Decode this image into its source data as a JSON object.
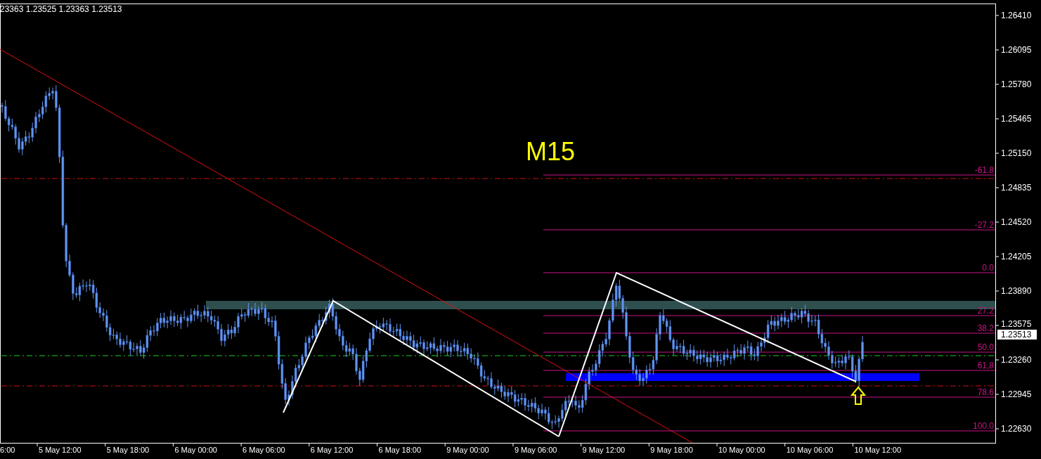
{
  "header": {
    "ohlc": "23363 1.23525 1.23363 1.23513"
  },
  "timeframe_label": "M15",
  "price_axis": {
    "labels": [
      "1.26410",
      "1.26095",
      "1.25780",
      "1.25465",
      "1.25150",
      "1.24835",
      "1.24520",
      "1.24205",
      "1.23890",
      "1.23575",
      "1.23260",
      "1.22945",
      "1.22630"
    ],
    "current_price": "1.23513"
  },
  "time_axis": {
    "labels": [
      "6:00",
      "5 May 12:00",
      "5 May 18:00",
      "6 May 00:00",
      "6 May 06:00",
      "6 May 12:00",
      "6 May 18:00",
      "9 May 00:00",
      "9 May 06:00",
      "9 May 12:00",
      "9 May 18:00",
      "10 May 00:00",
      "10 May 06:00",
      "10 May 12:00"
    ]
  },
  "fibonacci": {
    "levels": [
      "-61.8",
      "-27.2",
      "0.0",
      "27.2",
      "38.2",
      "50.0",
      "61,8",
      "78.6",
      "100.0"
    ]
  }
}
